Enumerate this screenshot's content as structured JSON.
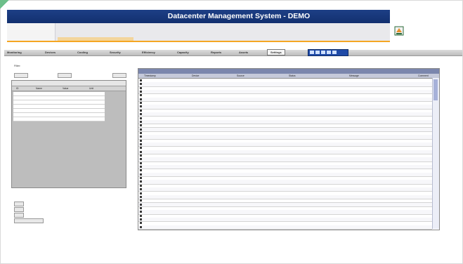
{
  "app": {
    "title": "Datacenter Management System - DEMO",
    "brand": ""
  },
  "colors": {
    "titlebar": "#1d3f86",
    "accent": "#f5a623",
    "grid_title": "#7b86ad"
  },
  "header_rows": [
    {
      "cells": [
        "",
        "",
        "",
        "",
        "",
        ""
      ]
    },
    {
      "cells": [
        "",
        "",
        "",
        "",
        "",
        ""
      ]
    },
    {
      "cells": [
        "",
        "",
        "",
        "",
        "",
        ""
      ]
    },
    {
      "cells": [
        "",
        "",
        "",
        "",
        "",
        ""
      ]
    }
  ],
  "nav": {
    "items": [
      "Monitoring",
      "Devices",
      "Cooling",
      "Security",
      "Efficiency",
      "Capacity",
      "Reports",
      "Assets",
      "Settings"
    ],
    "active": "Settings",
    "icons": [
      "grid-icon",
      "list-icon",
      "chart-icon",
      "expand-icon",
      "refresh-icon"
    ]
  },
  "left_pane": {
    "filter_label": "Filter:",
    "filter_value": "",
    "buttons": [
      "",
      "",
      ""
    ],
    "panel_title": "",
    "columns": [
      "ID",
      "Name",
      "Value",
      "Unit"
    ],
    "rows": [
      {
        "id": "",
        "name": "",
        "value": "",
        "unit": ""
      },
      {
        "id": "",
        "name": "",
        "value": "",
        "unit": ""
      },
      {
        "id": "",
        "name": "",
        "value": "",
        "unit": ""
      },
      {
        "id": "",
        "name": "",
        "value": "",
        "unit": ""
      },
      {
        "id": "",
        "name": "",
        "value": "",
        "unit": ""
      },
      {
        "id": "",
        "name": "",
        "value": "",
        "unit": ""
      },
      {
        "id": "",
        "name": "",
        "value": "",
        "unit": ""
      }
    ],
    "note": "",
    "extra": [
      {
        "btn": "",
        "val": ""
      },
      {
        "btn": "",
        "val": ""
      },
      {
        "btn": "",
        "val": ""
      }
    ],
    "apply_label": ""
  },
  "grid": {
    "title": "",
    "columns": [
      "Timestamp",
      "Device",
      "Source",
      "Status",
      "Message",
      "Comment"
    ],
    "rows": [
      {
        "ts": "",
        "dev": "",
        "src": "",
        "stat": "",
        "msg": "",
        "cmt": ""
      },
      {
        "ts": "",
        "dev": "",
        "src": "",
        "stat": "",
        "msg": "",
        "cmt": ""
      },
      {
        "ts": "",
        "dev": "",
        "src": "",
        "stat": "",
        "msg": "",
        "cmt": ""
      },
      {
        "ts": "",
        "dev": "",
        "src": "",
        "stat": "",
        "msg": "",
        "cmt": ""
      },
      {
        "ts": "",
        "dev": "",
        "src": "",
        "stat": "",
        "msg": "",
        "cmt": ""
      },
      {
        "ts": "",
        "dev": "",
        "src": "",
        "stat": "",
        "msg": "",
        "cmt": ""
      },
      {
        "ts": "",
        "dev": "",
        "src": "",
        "stat": "",
        "msg": "",
        "cmt": ""
      },
      {
        "ts": "",
        "dev": "",
        "src": "",
        "stat": "",
        "msg": "",
        "cmt": ""
      },
      {
        "ts": "",
        "dev": "",
        "src": "",
        "stat": "",
        "msg": "",
        "cmt": ""
      },
      {
        "ts": "",
        "dev": "",
        "src": "",
        "stat": "",
        "msg": "",
        "cmt": ""
      },
      {
        "ts": "",
        "dev": "",
        "src": "",
        "stat": "",
        "msg": "",
        "cmt": ""
      },
      {
        "ts": "",
        "dev": "",
        "src": "",
        "stat": "",
        "msg": "",
        "cmt": ""
      },
      {
        "ts": "",
        "dev": "",
        "src": "",
        "stat": "",
        "msg": "",
        "cmt": ""
      },
      {
        "ts": "",
        "dev": "",
        "src": "",
        "stat": "",
        "msg": "",
        "cmt": ""
      },
      {
        "ts": "",
        "dev": "",
        "src": "",
        "stat": "",
        "msg": "",
        "cmt": ""
      },
      {
        "ts": "",
        "dev": "",
        "src": "",
        "stat": "",
        "msg": "",
        "cmt": ""
      },
      {
        "ts": "",
        "dev": "",
        "src": "",
        "stat": "",
        "msg": "",
        "cmt": ""
      },
      {
        "ts": "",
        "dev": "",
        "src": "",
        "stat": "",
        "msg": "",
        "cmt": ""
      },
      {
        "ts": "",
        "dev": "",
        "src": "",
        "stat": "",
        "msg": "",
        "cmt": ""
      },
      {
        "ts": "",
        "dev": "",
        "src": "",
        "stat": "",
        "msg": "",
        "cmt": ""
      },
      {
        "ts": "",
        "dev": "",
        "src": "",
        "stat": "",
        "msg": "",
        "cmt": ""
      },
      {
        "ts": "",
        "dev": "",
        "src": "",
        "stat": "",
        "msg": "",
        "cmt": ""
      },
      {
        "ts": "",
        "dev": "",
        "src": "",
        "stat": "",
        "msg": "",
        "cmt": ""
      },
      {
        "ts": "",
        "dev": "",
        "src": "",
        "stat": "",
        "msg": "",
        "cmt": ""
      },
      {
        "ts": "",
        "dev": "",
        "src": "",
        "stat": "",
        "msg": "",
        "cmt": ""
      },
      {
        "ts": "",
        "dev": "",
        "src": "",
        "stat": "",
        "msg": "",
        "cmt": ""
      },
      {
        "ts": "",
        "dev": "",
        "src": "",
        "stat": "",
        "msg": "",
        "cmt": ""
      },
      {
        "ts": "",
        "dev": "",
        "src": "",
        "stat": "",
        "msg": "",
        "cmt": ""
      },
      {
        "ts": "",
        "dev": "",
        "src": "",
        "stat": "",
        "msg": "",
        "cmt": ""
      },
      {
        "ts": "",
        "dev": "",
        "src": "",
        "stat": "",
        "msg": "",
        "cmt": ""
      },
      {
        "ts": "",
        "dev": "",
        "src": "",
        "stat": "",
        "msg": "",
        "cmt": ""
      },
      {
        "ts": "",
        "dev": "",
        "src": "",
        "stat": "",
        "msg": "",
        "cmt": ""
      },
      {
        "ts": "",
        "dev": "",
        "src": "",
        "stat": "",
        "msg": "",
        "cmt": ""
      },
      {
        "ts": "",
        "dev": "",
        "src": "",
        "stat": "",
        "msg": "",
        "cmt": ""
      },
      {
        "ts": "",
        "dev": "",
        "src": "",
        "stat": "",
        "msg": "",
        "cmt": ""
      },
      {
        "ts": "",
        "dev": "",
        "src": "",
        "stat": "",
        "msg": "",
        "cmt": ""
      },
      {
        "ts": "",
        "dev": "",
        "src": "",
        "stat": "",
        "msg": "",
        "cmt": ""
      },
      {
        "ts": "",
        "dev": "",
        "src": "",
        "stat": "",
        "msg": "",
        "cmt": ""
      },
      {
        "ts": "",
        "dev": "",
        "src": "",
        "stat": "",
        "msg": "",
        "cmt": ""
      },
      {
        "ts": "",
        "dev": "",
        "src": "",
        "stat": "",
        "msg": "",
        "cmt": ""
      }
    ]
  }
}
